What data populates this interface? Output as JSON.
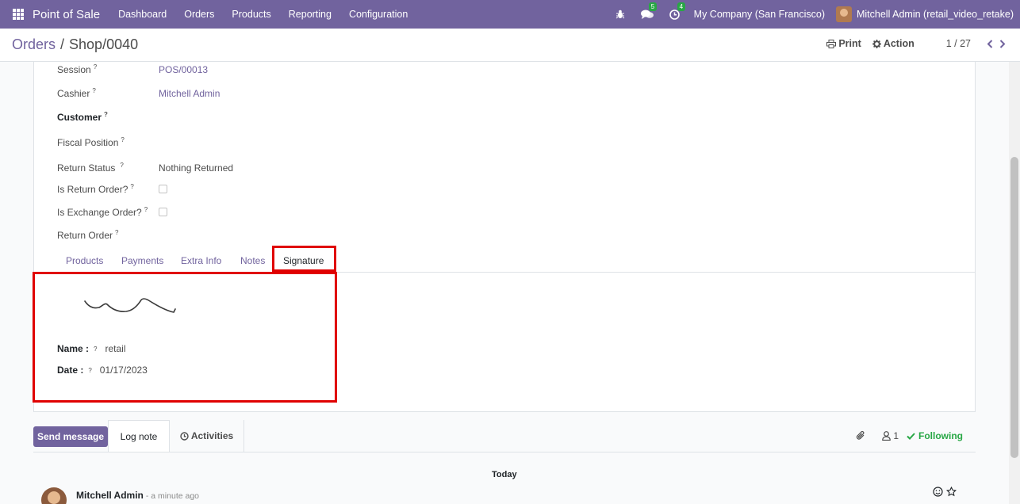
{
  "navbar": {
    "brand": "Point of Sale",
    "menu": [
      "Dashboard",
      "Orders",
      "Products",
      "Reporting",
      "Configuration"
    ],
    "messages_count": "5",
    "activities_count": "4",
    "company": "My Company (San Francisco)",
    "user": "Mitchell Admin (retail_video_retake)"
  },
  "control_panel": {
    "breadcrumb_parent": "Orders",
    "breadcrumb_separator": "/",
    "breadcrumb_current": "Shop/0040",
    "print_label": "Print",
    "action_label": "Action",
    "pager": "1 / 27"
  },
  "form": {
    "session_label": "Session",
    "session_value": "POS/00013",
    "cashier_label": "Cashier",
    "cashier_value": "Mitchell Admin",
    "customer_label": "Customer",
    "fiscal_label": "Fiscal Position",
    "return_status_label": "Return Status",
    "return_status_value": "Nothing Returned",
    "is_return_label": "Is Return Order?",
    "is_exchange_label": "Is Exchange Order?",
    "return_order_label": "Return Order",
    "help_mark": "?"
  },
  "tabs": [
    "Products",
    "Payments",
    "Extra Info",
    "Notes",
    "Signature"
  ],
  "signature": {
    "name_label": "Name :",
    "name_value": "retail",
    "date_label": "Date :",
    "date_value": "01/17/2023"
  },
  "chatter": {
    "send_message": "Send message",
    "log_note": "Log note",
    "activities": "Activities",
    "followers_count": "1",
    "following": "Following",
    "today": "Today",
    "author": "Mitchell Admin",
    "time": "- a minute ago"
  },
  "colors": {
    "brand": "#71639e",
    "highlight": "#e00000",
    "following": "#28a745"
  }
}
